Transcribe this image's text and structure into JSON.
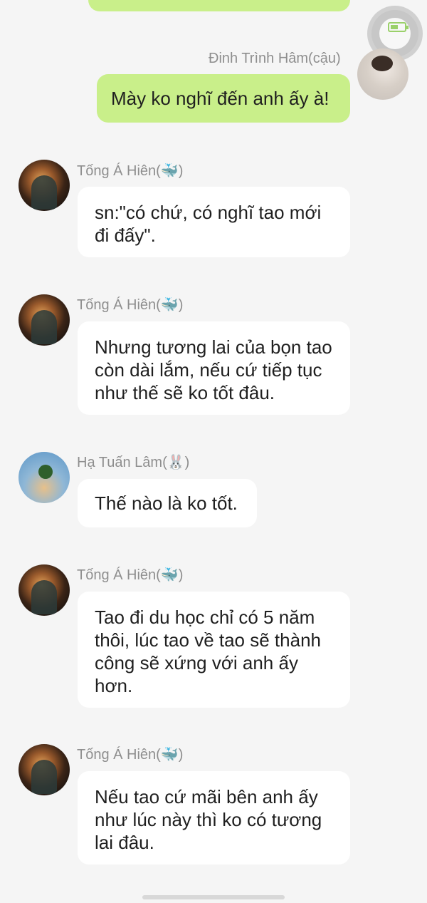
{
  "messages": [
    {
      "sender": "Đinh Trình Hâm(cậu)",
      "text": "Mày ko nghĩ đến anh ấy à!"
    },
    {
      "sender": "Tống Á Hiên(🐳)",
      "text": "sn:\"có chứ, có nghĩ tao mới đi đấy\"."
    },
    {
      "sender": "Tống Á Hiên(🐳)",
      "text": "Nhưng tương lai của bọn tao còn dài lắm, nếu cứ tiếp tục như thế sẽ ko tốt đâu."
    },
    {
      "sender": "Hạ Tuấn Lâm(🐰)",
      "text": "Thế nào là ko tốt."
    },
    {
      "sender": "Tống Á Hiên(🐳)",
      "text": "Tao đi du học chỉ có 5 năm thôi, lúc tao về tao sẽ thành công sẽ xứng với anh ấy hơn."
    },
    {
      "sender": "Tống Á Hiên(🐳)",
      "text": "Nếu tao cứ mãi bên anh ấy như lúc này thì ko có tương lai đâu."
    }
  ],
  "icons": {
    "floating": "floating-assist-icon",
    "battery": "battery-icon"
  },
  "colors": {
    "outgoing_bubble": "#c9ef8a",
    "incoming_bubble": "#ffffff",
    "background": "#f5f5f5"
  }
}
